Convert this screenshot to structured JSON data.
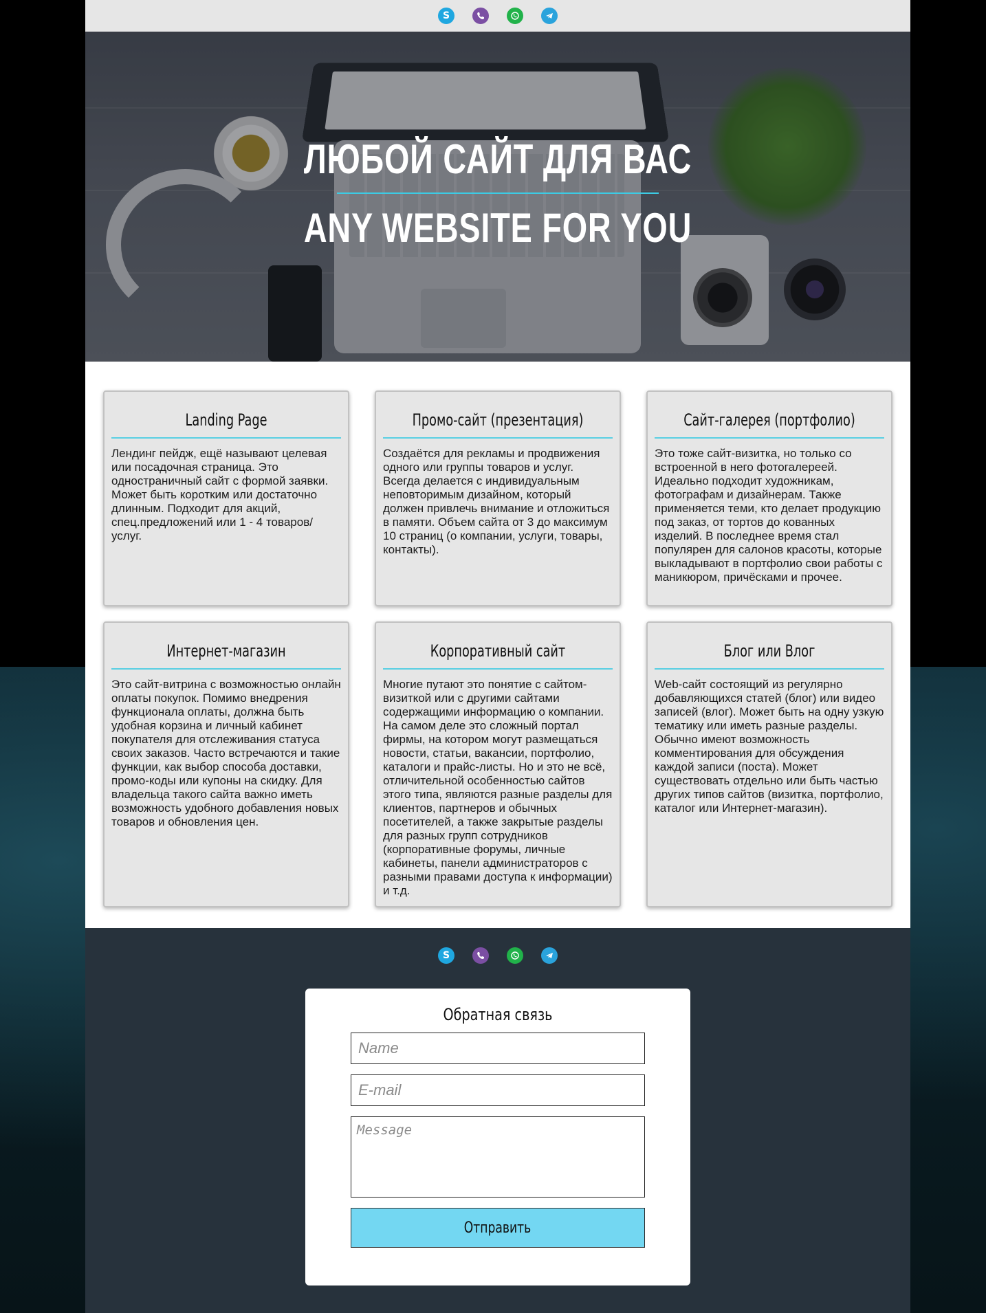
{
  "messengers": [
    {
      "name": "Skype",
      "glyph": "S",
      "color": "#1fa7e0"
    },
    {
      "name": "Viber",
      "color": "#7b4fa3"
    },
    {
      "name": "WhatsApp",
      "color": "#21b24a"
    },
    {
      "name": "Telegram",
      "color": "#2aa3dc"
    }
  ],
  "hero": {
    "title_ru": "ЛЮБОЙ САЙТ ДЛЯ ВАС",
    "title_en": "ANY WEBSITE FOR YOU"
  },
  "cards": [
    {
      "title": "Landing Page",
      "text": "Лендинг пейдж, ещё называют целевая или посадочная страница. Это одностраничный сайт с формой заявки. Может быть коротким или достаточно длинным. Подходит для акций, спец.предложений или 1 - 4 товаров/услуг."
    },
    {
      "title": "Промо-сайт (презентация)",
      "text": "Создаётся для рекламы и продвижения одного или группы товаров и услуг. Всегда делается с индивидуальным неповторимым дизайном, который должен привлечь внимание и отложиться в памяти. Объем сайта от 3 до максимум 10 страниц (о компании, услуги, товары, контакты)."
    },
    {
      "title": "Сайт-галерея (портфолио)",
      "text": "Это тоже сайт-визитка, но только со встроенной в него фотогалереей. Идеально подходит художникам, фотографам и дизайнерам. Также применяется теми, кто делает продукцию под заказ, от тортов до кованных изделий. В последнее время стал популярен для салонов красоты, которые выкладывают в портфолио свои работы с маникюром, причёсками и прочее."
    },
    {
      "title": "Интернет-магазин",
      "text": "Это сайт-витрина с возможностью онлайн оплаты покупок. Помимо внедрения функционала оплаты, должна быть удобная корзина и личный кабинет покупателя для отслеживания статуса своих заказов. Часто встречаются и такие функции, как выбор способа доставки, промо-коды или купоны на скидку. Для владельца такого сайта важно иметь возможность удобного добавления новых товаров и обновления цен."
    },
    {
      "title": "Корпоративный сайт",
      "text": "Многие путают это понятие с сайтом-визиткой или с другими сайтами содержащими информацию о компании. На самом деле это сложный портал фирмы, на котором могут размещаться новости, статьи, вакансии, портфолио, каталоги и прайс-листы. Но и это не всё, отличительной особенностью сайтов этого типа, являются разные разделы для клиентов, партнеров и обычных посетителей, а также закрытые разделы для разных групп сотрудников (корпоративные форумы, личные кабинеты, панели администраторов с разными правами доступа к информации) и т.д."
    },
    {
      "title": "Блог или Влог",
      "text": "Web-сайт состоящий из регулярно добавляющихся статей (блог) или видео записей (влог). Может быть на одну узкую тематику или иметь разные разделы. Обычно имеют возможность комментирования для обсуждения каждой записи (поста). Может существовать отдельно или быть частью других типов сайтов (визитка, портфолио, каталог или Интернет-магазин)."
    }
  ],
  "form": {
    "title": "Обратная связь",
    "name_placeholder": "Name",
    "email_placeholder": "E-mail",
    "message_placeholder": "Message",
    "submit_label": "Отправить"
  },
  "colors": {
    "accent": "#3ccbe4",
    "button": "#73d7f2",
    "footer": "#27323c",
    "card": "#e6e6e6"
  }
}
